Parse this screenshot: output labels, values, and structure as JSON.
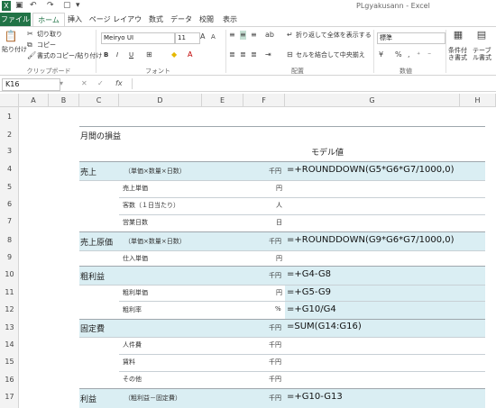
{
  "title_bar": {
    "app_title": "PLgyakusann - Excel"
  },
  "ribbon": {
    "tabs": [
      "ファイル",
      "ホーム",
      "挿入",
      "ページ レイアウト",
      "数式",
      "データ",
      "校閲",
      "表示"
    ],
    "clipboard": {
      "paste": "貼り付け",
      "cut": "切り取り",
      "copy": "コピー",
      "format_painter": "書式のコピー/貼り付け",
      "group": "クリップボード"
    },
    "font": {
      "name": "Meiryo UI",
      "size": "11",
      "group": "フォント",
      "bold": "B",
      "italic": "I",
      "underline": "U"
    },
    "alignment": {
      "wrap": "折り返して全体を表示する",
      "merge": "セルを結合して中央揃え",
      "group": "配置"
    },
    "number": {
      "format": "標準",
      "group": "数値"
    },
    "styles": {
      "conditional": "条件付き書式",
      "table": "テーブル書式設定"
    }
  },
  "formula_bar": {
    "name_box": "K16",
    "fx": "fx"
  },
  "columns": [
    "A",
    "B",
    "C",
    "D",
    "E",
    "F",
    "G",
    "H"
  ],
  "rows": [
    "1",
    "2",
    "3",
    "4",
    "5",
    "6",
    "7",
    "8",
    "9",
    "10",
    "11",
    "12",
    "13",
    "14",
    "15",
    "16",
    "17"
  ],
  "sheet": {
    "title": "月間の損益",
    "model_value_header": "モデル値",
    "rows": [
      {
        "row": "4",
        "label": "売上",
        "note": "（単価×数量×日数）",
        "unit": "千円",
        "formula": "=+ROUNDDOWN(G5*G6*G7/1000,0)"
      },
      {
        "row": "5",
        "sub": "売上単価",
        "unit": "円"
      },
      {
        "row": "6",
        "sub": "客数（１日当たり）",
        "unit": "人"
      },
      {
        "row": "7",
        "sub": "営業日数",
        "unit": "日"
      },
      {
        "row": "8",
        "label": "売上原価",
        "note": "（単価×数量×日数）",
        "unit": "千円",
        "formula": "=+ROUNDDOWN(G9*G6*G7/1000,0)"
      },
      {
        "row": "9",
        "sub": "仕入単価",
        "unit": "円"
      },
      {
        "row": "10",
        "label": "粗利益",
        "unit": "千円",
        "formula": "=+G4-G8"
      },
      {
        "row": "11",
        "sub": "粗利単価",
        "unit": "円",
        "formula": "=+G5-G9"
      },
      {
        "row": "12",
        "sub": "粗利率",
        "unit": "%",
        "formula": "=+G10/G4"
      },
      {
        "row": "13",
        "label": "固定費",
        "unit": "千円",
        "formula": "=SUM(G14:G16)"
      },
      {
        "row": "14",
        "sub": "人件費",
        "unit": "千円"
      },
      {
        "row": "15",
        "sub": "賃料",
        "unit": "千円"
      },
      {
        "row": "16",
        "sub": "その他",
        "unit": "千円"
      },
      {
        "row": "17",
        "label": "利益",
        "note": "（粗利益－固定費）",
        "unit": "千円",
        "formula": "=+G10-G13"
      }
    ]
  }
}
